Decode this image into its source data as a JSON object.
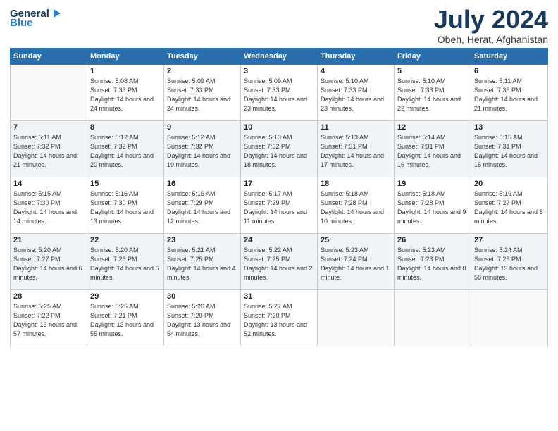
{
  "header": {
    "logo_line1": "General",
    "logo_line2": "Blue",
    "month": "July 2024",
    "location": "Obeh, Herat, Afghanistan"
  },
  "weekdays": [
    "Sunday",
    "Monday",
    "Tuesday",
    "Wednesday",
    "Thursday",
    "Friday",
    "Saturday"
  ],
  "weeks": [
    [
      {
        "day": "",
        "empty": true
      },
      {
        "day": "1",
        "sunrise": "5:08 AM",
        "sunset": "7:33 PM",
        "daylight": "14 hours and 24 minutes."
      },
      {
        "day": "2",
        "sunrise": "5:09 AM",
        "sunset": "7:33 PM",
        "daylight": "14 hours and 24 minutes."
      },
      {
        "day": "3",
        "sunrise": "5:09 AM",
        "sunset": "7:33 PM",
        "daylight": "14 hours and 23 minutes."
      },
      {
        "day": "4",
        "sunrise": "5:10 AM",
        "sunset": "7:33 PM",
        "daylight": "14 hours and 23 minutes."
      },
      {
        "day": "5",
        "sunrise": "5:10 AM",
        "sunset": "7:33 PM",
        "daylight": "14 hours and 22 minutes."
      },
      {
        "day": "6",
        "sunrise": "5:11 AM",
        "sunset": "7:33 PM",
        "daylight": "14 hours and 21 minutes."
      }
    ],
    [
      {
        "day": "7",
        "sunrise": "5:11 AM",
        "sunset": "7:32 PM",
        "daylight": "14 hours and 21 minutes."
      },
      {
        "day": "8",
        "sunrise": "5:12 AM",
        "sunset": "7:32 PM",
        "daylight": "14 hours and 20 minutes."
      },
      {
        "day": "9",
        "sunrise": "5:12 AM",
        "sunset": "7:32 PM",
        "daylight": "14 hours and 19 minutes."
      },
      {
        "day": "10",
        "sunrise": "5:13 AM",
        "sunset": "7:32 PM",
        "daylight": "14 hours and 18 minutes."
      },
      {
        "day": "11",
        "sunrise": "5:13 AM",
        "sunset": "7:31 PM",
        "daylight": "14 hours and 17 minutes."
      },
      {
        "day": "12",
        "sunrise": "5:14 AM",
        "sunset": "7:31 PM",
        "daylight": "14 hours and 16 minutes."
      },
      {
        "day": "13",
        "sunrise": "5:15 AM",
        "sunset": "7:31 PM",
        "daylight": "14 hours and 15 minutes."
      }
    ],
    [
      {
        "day": "14",
        "sunrise": "5:15 AM",
        "sunset": "7:30 PM",
        "daylight": "14 hours and 14 minutes."
      },
      {
        "day": "15",
        "sunrise": "5:16 AM",
        "sunset": "7:30 PM",
        "daylight": "14 hours and 13 minutes."
      },
      {
        "day": "16",
        "sunrise": "5:16 AM",
        "sunset": "7:29 PM",
        "daylight": "14 hours and 12 minutes."
      },
      {
        "day": "17",
        "sunrise": "5:17 AM",
        "sunset": "7:29 PM",
        "daylight": "14 hours and 11 minutes."
      },
      {
        "day": "18",
        "sunrise": "5:18 AM",
        "sunset": "7:28 PM",
        "daylight": "14 hours and 10 minutes."
      },
      {
        "day": "19",
        "sunrise": "5:18 AM",
        "sunset": "7:28 PM",
        "daylight": "14 hours and 9 minutes."
      },
      {
        "day": "20",
        "sunrise": "5:19 AM",
        "sunset": "7:27 PM",
        "daylight": "14 hours and 8 minutes."
      }
    ],
    [
      {
        "day": "21",
        "sunrise": "5:20 AM",
        "sunset": "7:27 PM",
        "daylight": "14 hours and 6 minutes."
      },
      {
        "day": "22",
        "sunrise": "5:20 AM",
        "sunset": "7:26 PM",
        "daylight": "14 hours and 5 minutes."
      },
      {
        "day": "23",
        "sunrise": "5:21 AM",
        "sunset": "7:25 PM",
        "daylight": "14 hours and 4 minutes."
      },
      {
        "day": "24",
        "sunrise": "5:22 AM",
        "sunset": "7:25 PM",
        "daylight": "14 hours and 2 minutes."
      },
      {
        "day": "25",
        "sunrise": "5:23 AM",
        "sunset": "7:24 PM",
        "daylight": "14 hours and 1 minute."
      },
      {
        "day": "26",
        "sunrise": "5:23 AM",
        "sunset": "7:23 PM",
        "daylight": "14 hours and 0 minutes."
      },
      {
        "day": "27",
        "sunrise": "5:24 AM",
        "sunset": "7:23 PM",
        "daylight": "13 hours and 58 minutes."
      }
    ],
    [
      {
        "day": "28",
        "sunrise": "5:25 AM",
        "sunset": "7:22 PM",
        "daylight": "13 hours and 57 minutes."
      },
      {
        "day": "29",
        "sunrise": "5:25 AM",
        "sunset": "7:21 PM",
        "daylight": "13 hours and 55 minutes."
      },
      {
        "day": "30",
        "sunrise": "5:26 AM",
        "sunset": "7:20 PM",
        "daylight": "13 hours and 54 minutes."
      },
      {
        "day": "31",
        "sunrise": "5:27 AM",
        "sunset": "7:20 PM",
        "daylight": "13 hours and 52 minutes."
      },
      {
        "day": "",
        "empty": true
      },
      {
        "day": "",
        "empty": true
      },
      {
        "day": "",
        "empty": true
      }
    ]
  ]
}
